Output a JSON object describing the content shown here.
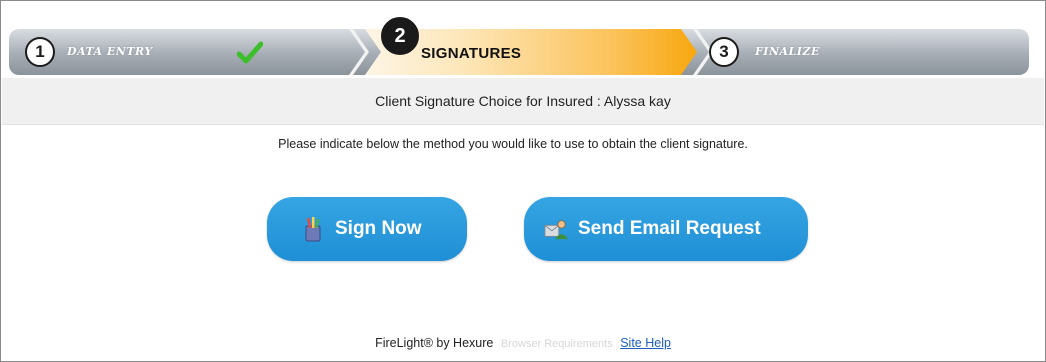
{
  "stepper": {
    "steps": [
      {
        "number": "1",
        "label": "DATA ENTRY",
        "state": "completed"
      },
      {
        "number": "2",
        "label": "SIGNATURES",
        "state": "active"
      },
      {
        "number": "3",
        "label": "FINALIZE",
        "state": "upcoming"
      }
    ],
    "completed_icon": "checkmark-icon"
  },
  "banner": {
    "text": "Client Signature Choice for Insured : Alyssa kay"
  },
  "instruction": "Please indicate below the method you would like to use to obtain the client signature.",
  "buttons": {
    "sign_now": {
      "label": "Sign Now",
      "icon": "pen-cup-icon"
    },
    "send_email": {
      "label": "Send Email Request",
      "icon": "email-user-icon"
    }
  },
  "footer": {
    "brand": "FireLight® by Hexure",
    "browser_requirements": "Browser Requirements",
    "site_help": "Site Help"
  },
  "colors": {
    "button_blue": "#2196d9",
    "active_step_orange": "#f7a70e",
    "check_green": "#3cbf2a",
    "link_blue": "#1d5fbf"
  }
}
